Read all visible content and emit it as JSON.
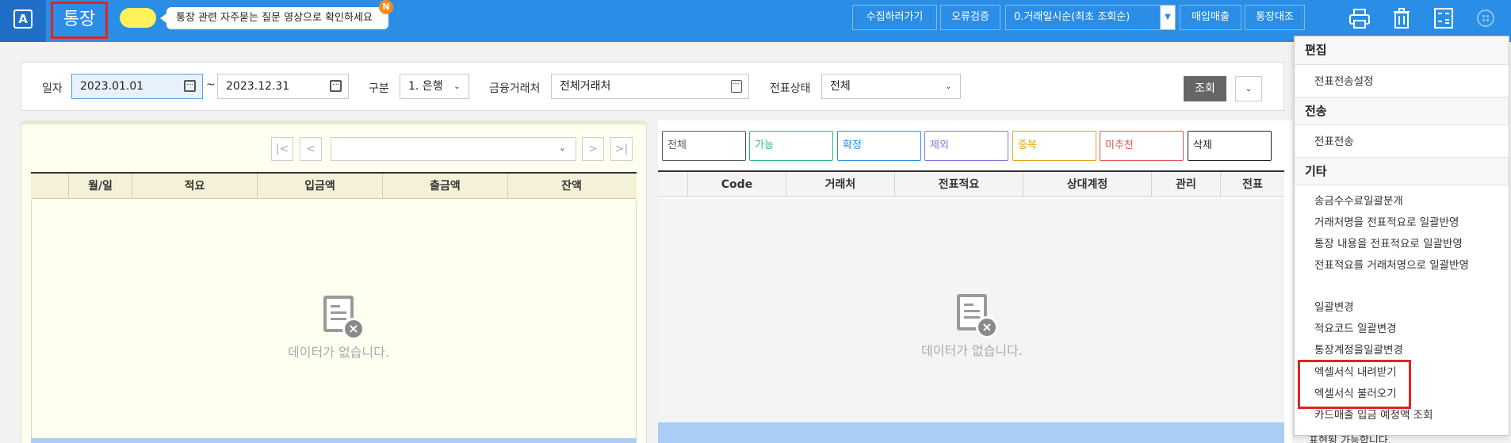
{
  "topbar": {
    "logo": "A",
    "title": "통장",
    "tip": "통장 관련 자주묻는 질문 영상으로 확인하세요",
    "tip_badge": "N",
    "buttons": [
      "수집하러가기",
      "오류검증"
    ],
    "sort_select": "0.거래일시순(최초 조회순)",
    "buttons2": [
      "매입매출",
      "통장대조"
    ],
    "icons": [
      "printer-icon",
      "trash-icon",
      "calculator-icon",
      "apps-icon"
    ]
  },
  "filters": {
    "date_label": "일자",
    "date_from": "2023.01.01",
    "tilde": "~",
    "date_to": "2023.12.31",
    "type_label": "구분",
    "type_value": "1. 은행",
    "account_label": "금융거래처",
    "account_value": "전체거래처",
    "status_label": "전표상태",
    "status_value": "전체",
    "search_button": "조회"
  },
  "left_grid": {
    "nav": [
      "|<",
      "<",
      ">",
      ">|"
    ],
    "columns": [
      "월/일",
      "적요",
      "입금액",
      "출금액",
      "잔액"
    ],
    "empty_text": "데이터가 없습니다."
  },
  "right_grid": {
    "chips": [
      {
        "label": "전체",
        "color": "#555555"
      },
      {
        "label": "가능",
        "color": "#2eb87a"
      },
      {
        "label": "확정",
        "color": "#2a8ee6"
      },
      {
        "label": "제외",
        "color": "#8a6fd6"
      },
      {
        "label": "중복",
        "color": "#e6a21a"
      },
      {
        "label": "미추천",
        "color": "#e05555"
      },
      {
        "label": "삭제",
        "color": "#222222"
      }
    ],
    "columns": [
      "Code",
      "거래처",
      "전표적요",
      "상대계정",
      "관리",
      "전표"
    ],
    "empty_text": "데이터가 없습니다."
  },
  "menu": {
    "sections": [
      {
        "title": "편집",
        "items": [
          "전표전송설정"
        ]
      },
      {
        "title": "전송",
        "items": [
          "전표전송"
        ]
      },
      {
        "title": "기타",
        "items": [
          "송금수수료일괄분개",
          "거래처명을 전표적요로 일괄반영",
          "통장 내용을 전표적요로 일괄반영",
          "전표적요를 거래처명으로 일괄반영",
          "일괄변경",
          "적요코드 일괄변경",
          "통장계정을일괄변경",
          "엑셀서식 내려받기",
          "엑셀서식 불러오기",
          "카드매출 입금 예정액 조회"
        ]
      }
    ],
    "behind_text": "표현됭 가능합니다."
  }
}
